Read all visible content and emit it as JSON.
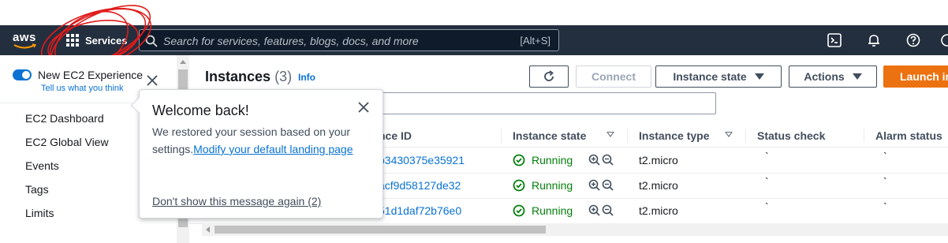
{
  "topbar": {
    "logo": "aws",
    "services_label": "Services",
    "search_placeholder": "Search for services, features, blogs, docs, and more",
    "search_shortcut": "[Alt+S]"
  },
  "sidebar": {
    "toggle_label": "New EC2 Experience",
    "tell_us": "Tell us what you think",
    "items": [
      "EC2 Dashboard",
      "EC2 Global View",
      "Events",
      "Tags",
      "Limits"
    ]
  },
  "panel": {
    "title": "Instances",
    "count": "(3)",
    "info": "Info",
    "buttons": {
      "connect": "Connect",
      "instance_state": "Instance state",
      "actions": "Actions",
      "launch": "Launch in"
    }
  },
  "table": {
    "headers": [
      "nce ID",
      "Instance state",
      "Instance type",
      "Status check",
      "Alarm status"
    ],
    "rows": [
      {
        "id": "b3430375e35921",
        "state": "Running",
        "type": "t2.micro",
        "status": "`",
        "alarm": "`"
      },
      {
        "id": "acf9d58127de32",
        "state": "Running",
        "type": "t2.micro",
        "status": "`",
        "alarm": "`"
      },
      {
        "id": "51d1daf72b76e0",
        "state": "Running",
        "type": "t2.micro",
        "status": "`",
        "alarm": "`"
      }
    ]
  },
  "popover": {
    "title": "Welcome back!",
    "body_text": "We restored your session based on your settings.",
    "body_link": "Modify your default landing page",
    "dont_show": "Don't show this message again (2)"
  },
  "colors": {
    "topbar": "#232f3e",
    "link": "#0972d3",
    "running": "#037f0c",
    "primary": "#ec7211",
    "annotation": "#e01b1b"
  }
}
